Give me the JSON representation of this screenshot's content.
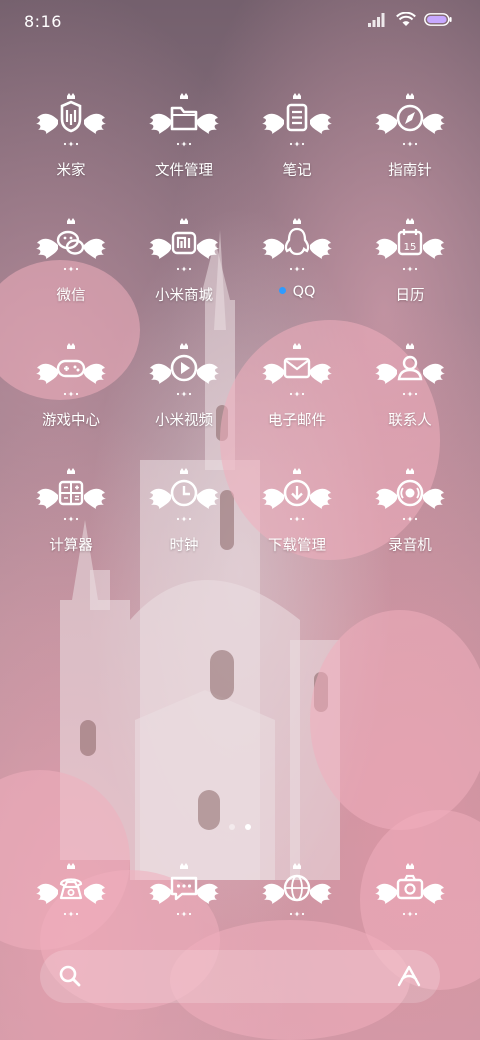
{
  "status_bar": {
    "time": "8:16",
    "icons": [
      "signal-icon",
      "wifi-icon",
      "battery-icon"
    ]
  },
  "apps": [
    {
      "label": "米家",
      "icon": "mi-home-icon"
    },
    {
      "label": "文件管理",
      "icon": "folder-icon"
    },
    {
      "label": "笔记",
      "icon": "notes-icon"
    },
    {
      "label": "指南针",
      "icon": "compass-icon"
    },
    {
      "label": "微信",
      "icon": "wechat-icon"
    },
    {
      "label": "小米商城",
      "icon": "mi-store-icon"
    },
    {
      "label": "QQ",
      "icon": "qq-icon",
      "notification_dot": true
    },
    {
      "label": "日历",
      "icon": "calendar-icon",
      "icon_text": "15"
    },
    {
      "label": "游戏中心",
      "icon": "gamepad-icon"
    },
    {
      "label": "小米视频",
      "icon": "video-play-icon"
    },
    {
      "label": "电子邮件",
      "icon": "mail-icon"
    },
    {
      "label": "联系人",
      "icon": "contacts-icon"
    },
    {
      "label": "计算器",
      "icon": "calculator-icon"
    },
    {
      "label": "时钟",
      "icon": "clock-icon"
    },
    {
      "label": "下载管理",
      "icon": "download-icon"
    },
    {
      "label": "录音机",
      "icon": "recorder-icon"
    }
  ],
  "page_indicator": {
    "pages": 2,
    "active": 2
  },
  "dock": [
    {
      "icon": "phone-icon"
    },
    {
      "icon": "messages-icon"
    },
    {
      "icon": "browser-globe-icon"
    },
    {
      "icon": "camera-icon"
    }
  ],
  "search_bar": {
    "left_icon": "search-icon",
    "right_icon": "assistant-icon"
  },
  "colors": {
    "notification_dot": "#2f9bff",
    "text": "#ffffff"
  }
}
